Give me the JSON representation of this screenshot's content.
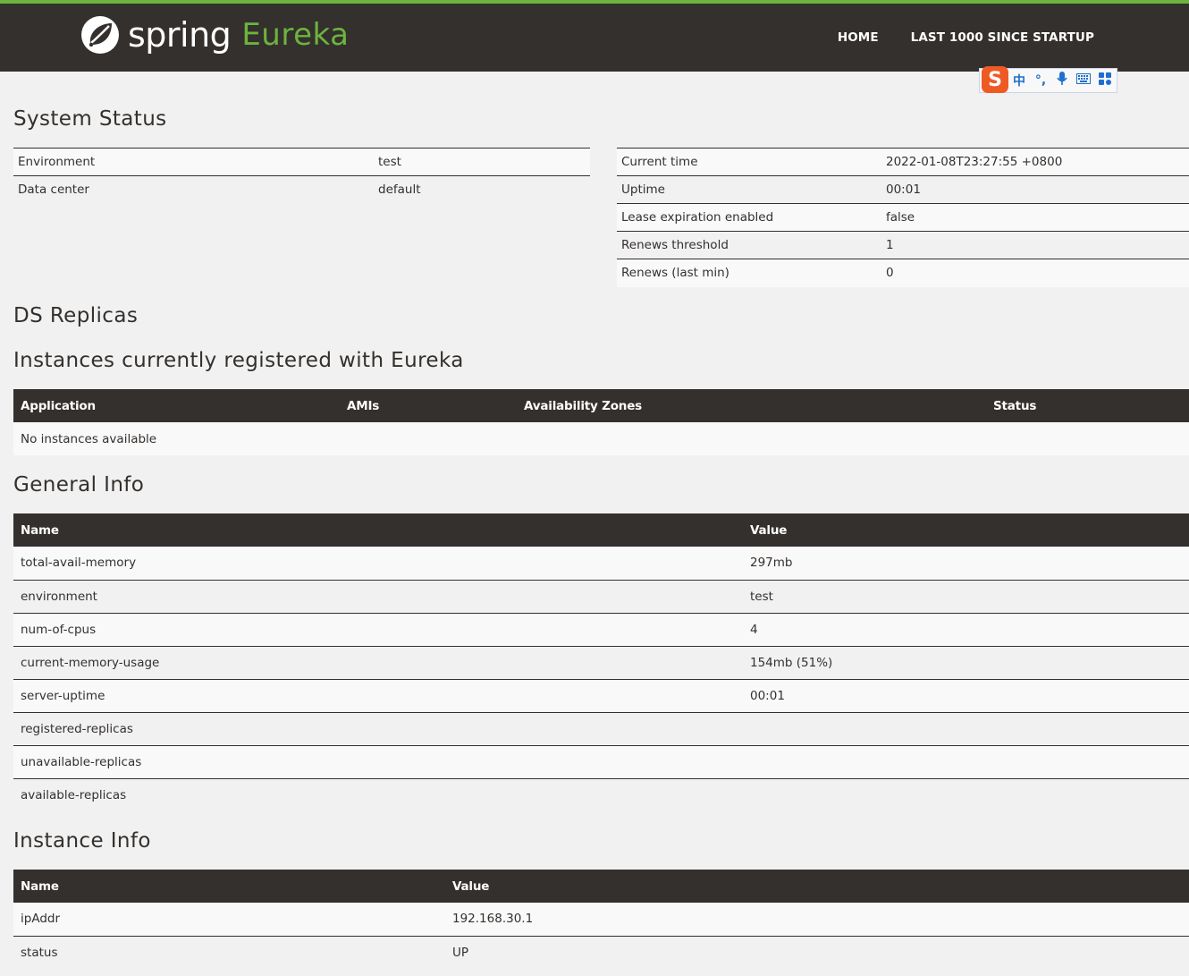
{
  "brand": {
    "name_primary": "spring",
    "name_secondary": "Eureka",
    "accent": "#6db33f",
    "header_bg": "#34302d"
  },
  "nav": {
    "home": "HOME",
    "last1000": "LAST 1000 SINCE STARTUP"
  },
  "ime_toolbar": {
    "logo": "S",
    "lang": "中",
    "punct": "°,",
    "mic": "mic-icon",
    "keyboard": "keyboard-icon",
    "apps": "grid-icon"
  },
  "system_status": {
    "title": "System Status",
    "left": [
      {
        "key": "Environment",
        "value": "test"
      },
      {
        "key": "Data center",
        "value": "default"
      }
    ],
    "right": [
      {
        "key": "Current time",
        "value": "2022-01-08T23:27:55 +0800"
      },
      {
        "key": "Uptime",
        "value": "00:01"
      },
      {
        "key": "Lease expiration enabled",
        "value": "false"
      },
      {
        "key": "Renews threshold",
        "value": "1"
      },
      {
        "key": "Renews (last min)",
        "value": "0"
      }
    ]
  },
  "ds_replicas": {
    "title": "DS Replicas"
  },
  "instances": {
    "title": "Instances currently registered with Eureka",
    "headers": [
      "Application",
      "AMIs",
      "Availability Zones",
      "Status"
    ],
    "empty_text": "No instances available"
  },
  "general_info": {
    "title": "General Info",
    "headers": [
      "Name",
      "Value"
    ],
    "rows": [
      {
        "name": "total-avail-memory",
        "value": "297mb"
      },
      {
        "name": "environment",
        "value": "test"
      },
      {
        "name": "num-of-cpus",
        "value": "4"
      },
      {
        "name": "current-memory-usage",
        "value": "154mb (51%)"
      },
      {
        "name": "server-uptime",
        "value": "00:01"
      },
      {
        "name": "registered-replicas",
        "value": ""
      },
      {
        "name": "unavailable-replicas",
        "value": ""
      },
      {
        "name": "available-replicas",
        "value": ""
      }
    ]
  },
  "instance_info": {
    "title": "Instance Info",
    "headers": [
      "Name",
      "Value"
    ],
    "rows": [
      {
        "name": "ipAddr",
        "value": "192.168.30.1"
      },
      {
        "name": "status",
        "value": "UP"
      }
    ]
  }
}
